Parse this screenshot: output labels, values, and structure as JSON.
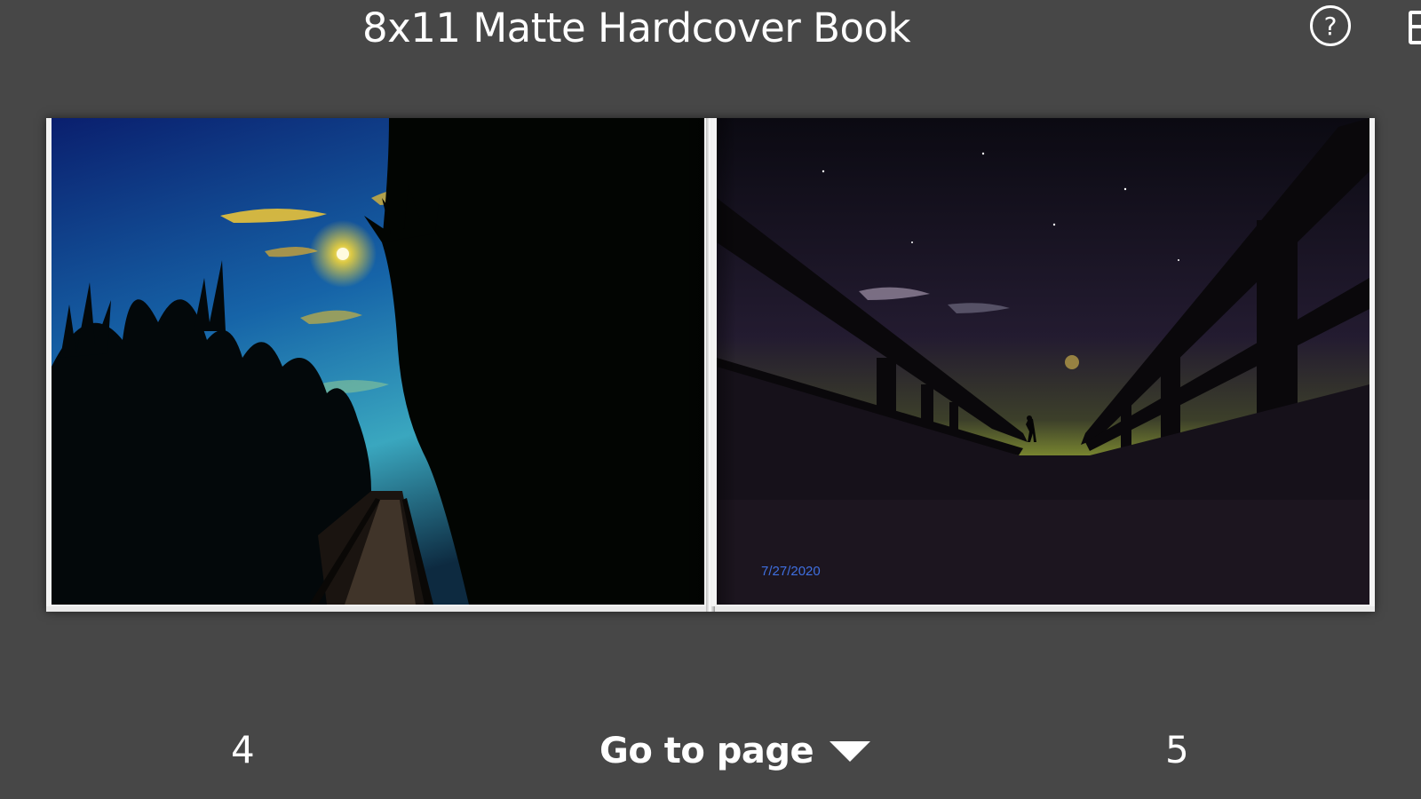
{
  "header": {
    "title": "8x11 Matte Hardcover Book",
    "help_icon": "question-circle-icon",
    "help_label": "?",
    "edge_icon": "book-icon"
  },
  "spread": {
    "left_page": {
      "photo": "night-boardwalk-moon-pine-trees"
    },
    "right_page": {
      "photo": "night-boardwalk-railing-silhouette-stars",
      "date_stamp": "7/27/2020",
      "date_stamp_color": "#3f6fe0"
    }
  },
  "footer": {
    "left_page_number": "4",
    "goto_label": "Go to page",
    "goto_icon": "caret-down-icon",
    "right_page_number": "5"
  },
  "colors": {
    "background": "#474747",
    "text": "#ffffff"
  }
}
